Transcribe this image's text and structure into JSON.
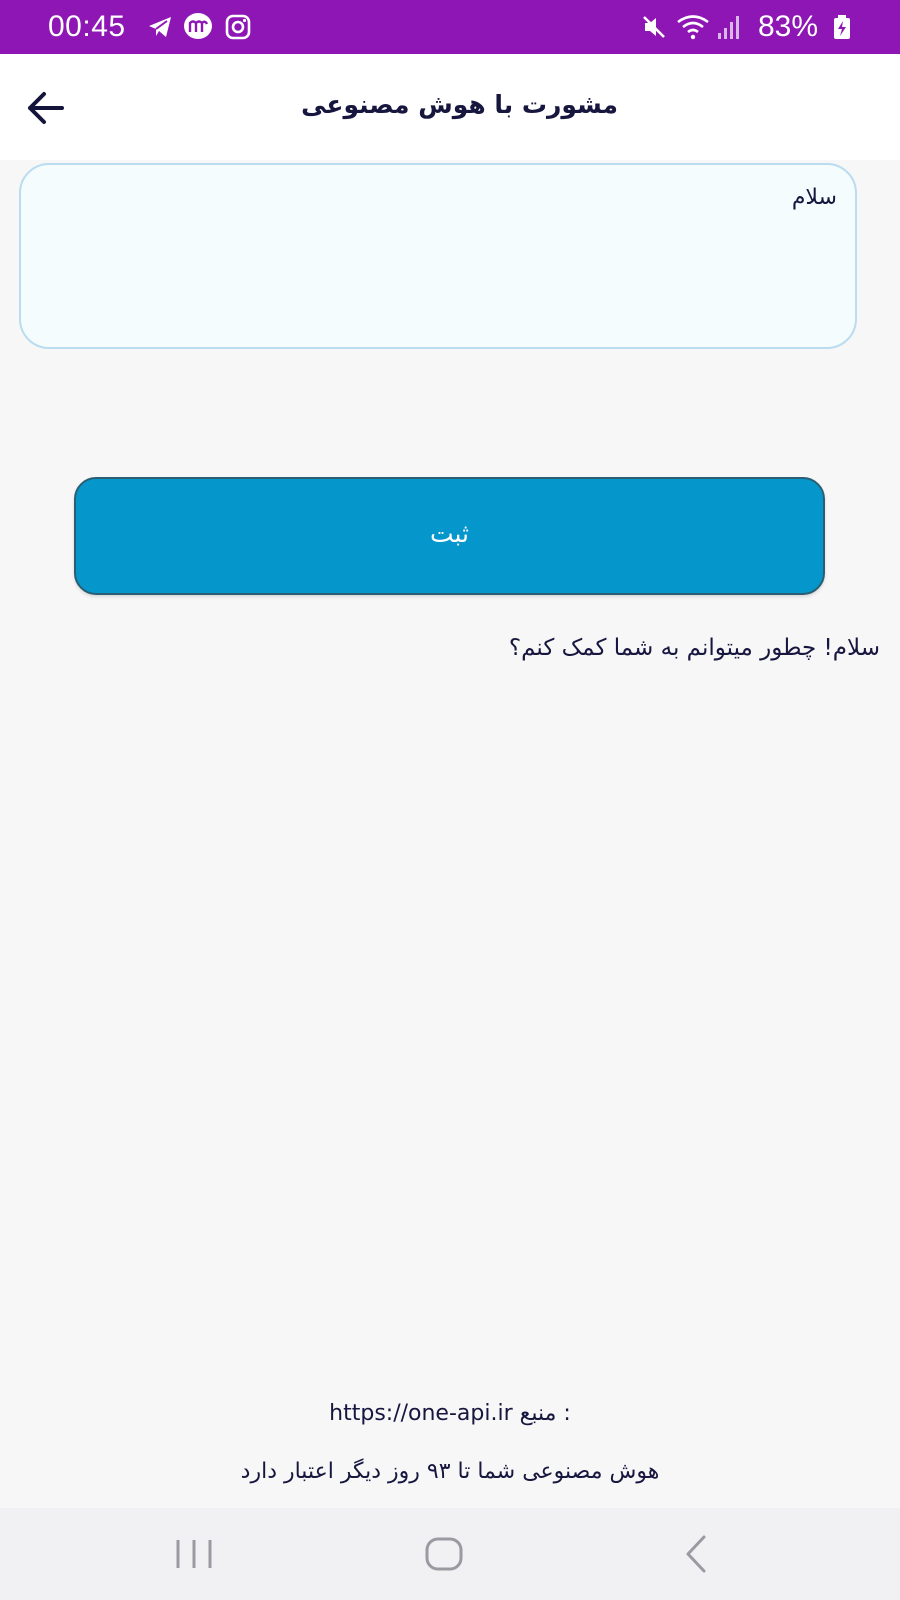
{
  "status_bar": {
    "time": "00:45",
    "battery": "83%",
    "icons": [
      "telegram-icon",
      "messenger-icon",
      "instagram-icon",
      "mute-icon",
      "wifi-icon",
      "signal-icon",
      "battery-icon"
    ]
  },
  "app_bar": {
    "title": "مشورت با هوش مصنوعی",
    "back_icon": "arrow-left-icon"
  },
  "input": {
    "value": "سلام"
  },
  "submit": {
    "label": "ثبت"
  },
  "response": {
    "text": "سلام! چطور میتوانم به شما کمک کنم؟"
  },
  "footer": {
    "source_label": "منبع :",
    "source_url": "https://one-api.ir",
    "validity_text": "هوش مصنوعی شما تا ۹۳ روز دیگر اعتبار دارد"
  },
  "nav_bar": {
    "icons": [
      "recents-icon",
      "home-icon",
      "back-icon"
    ]
  },
  "colors": {
    "status_bar": "#8e16b5",
    "button": "#0596cc",
    "input_border": "#b9dcf0",
    "text": "#16163f"
  }
}
